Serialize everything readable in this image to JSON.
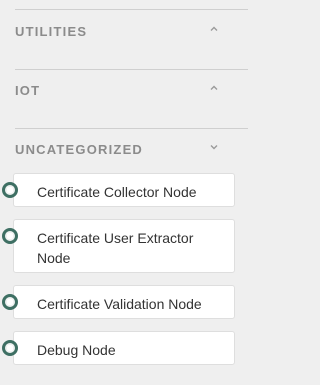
{
  "palette": {
    "sections": [
      {
        "title": "UTILITIES",
        "expanded": false,
        "chevron_icon": "chevron-up-icon"
      },
      {
        "title": "IOT",
        "expanded": false,
        "chevron_icon": "chevron-up-icon"
      },
      {
        "title": "UNCATEGORIZED",
        "expanded": true,
        "chevron_icon": "chevron-down-icon"
      }
    ],
    "nodes": [
      {
        "label": "Certificate Collector Node",
        "icon": "node-port-icon"
      },
      {
        "label": "Certificate User Extractor Node",
        "icon": "node-port-icon"
      },
      {
        "label": "Certificate Validation Node",
        "icon": "node-port-icon"
      },
      {
        "label": "Debug Node",
        "icon": "node-port-icon"
      }
    ],
    "colors": {
      "background": "#efefef",
      "section_title": "#8b8b8b",
      "divider": "#cfcfcf",
      "node_background": "#ffffff",
      "node_border": "#dedede",
      "node_text": "#333333",
      "port_ring": "#3e6f63"
    }
  }
}
